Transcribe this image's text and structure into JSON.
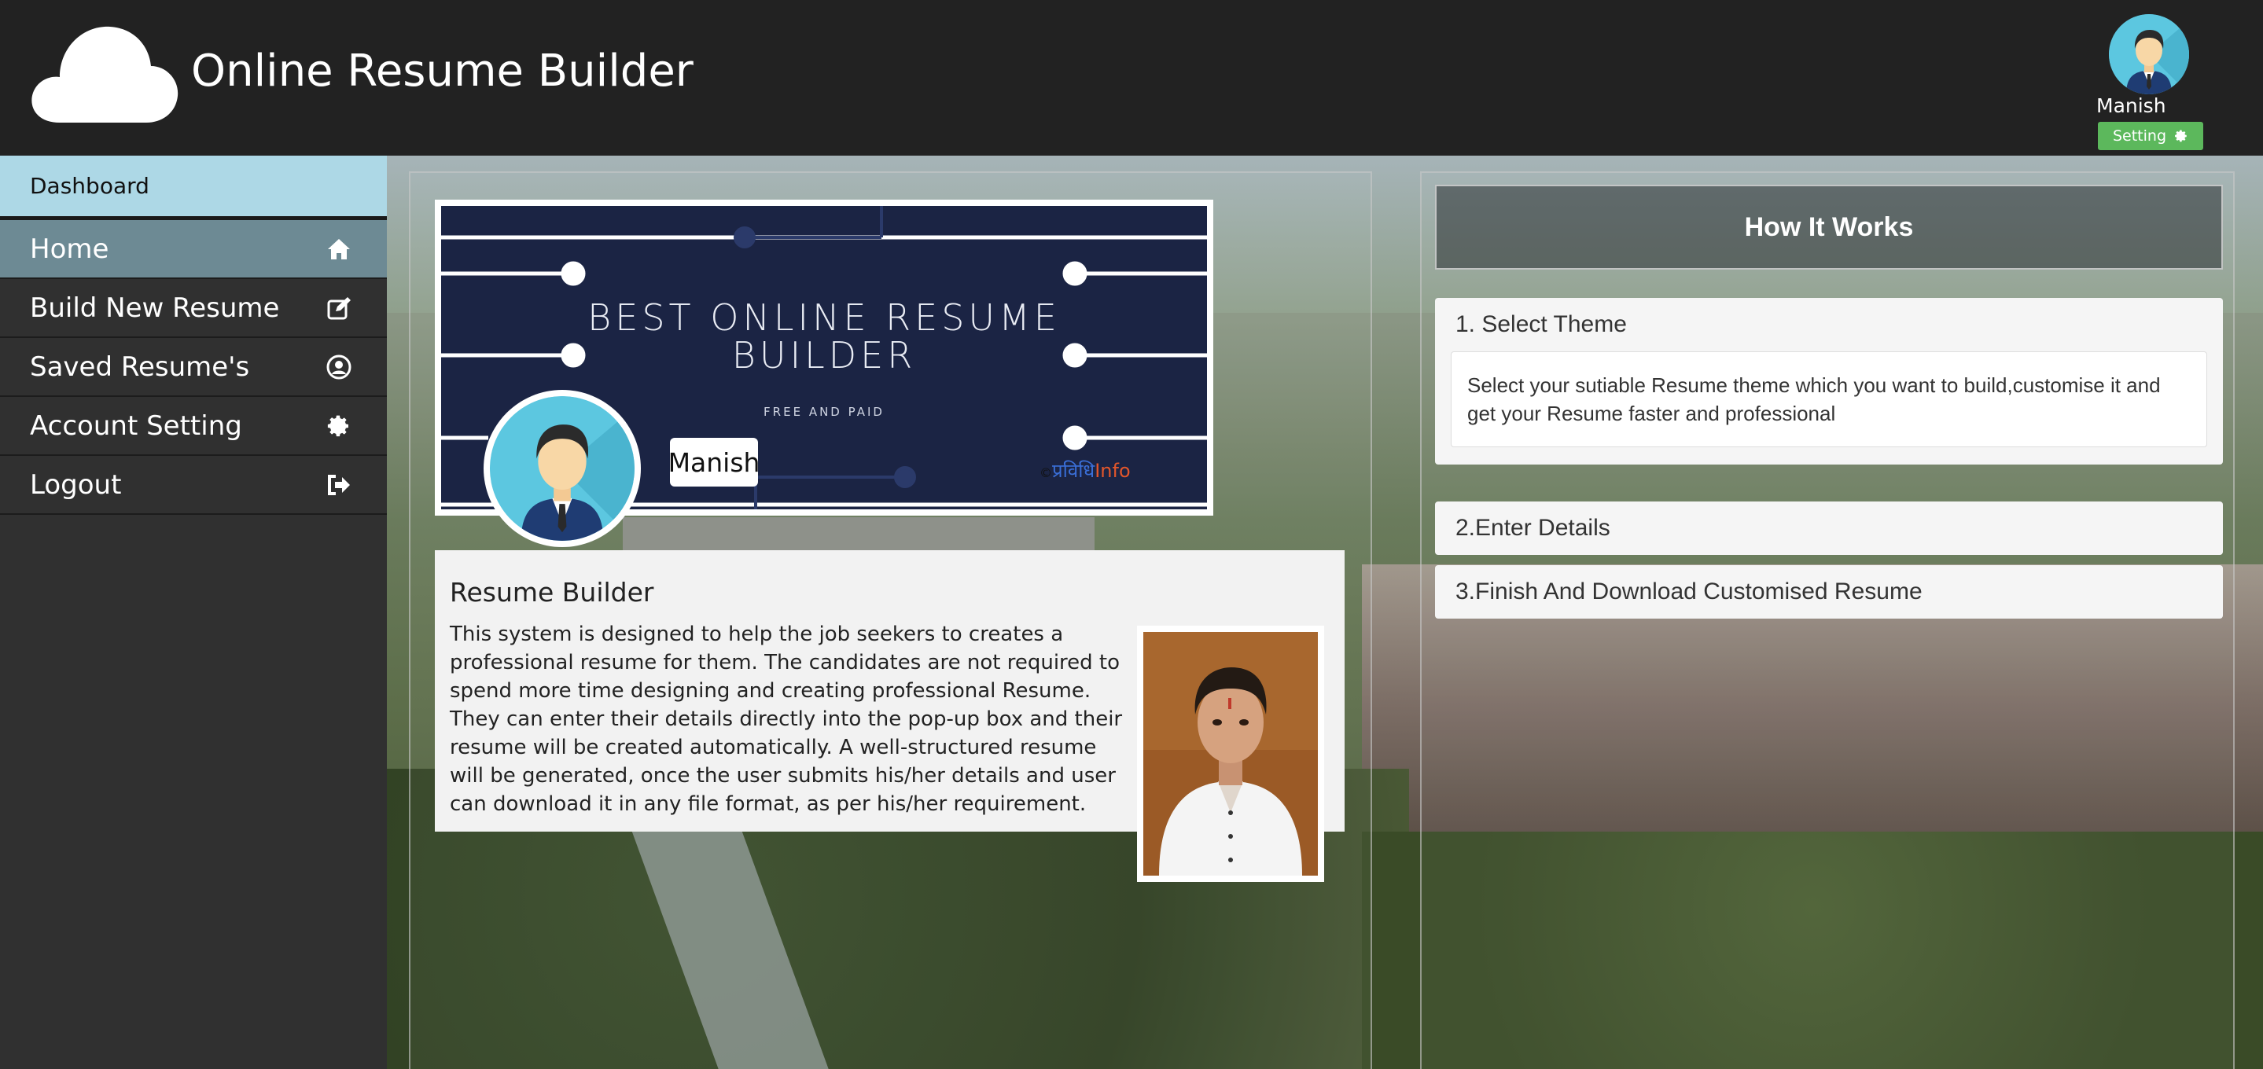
{
  "header": {
    "title": "Online Resume Builder",
    "user_name": "Manish",
    "setting_label": "Setting"
  },
  "sidebar": {
    "heading": "Dashboard",
    "items": [
      {
        "label": "Home",
        "icon": "home-icon"
      },
      {
        "label": "Build New Resume",
        "icon": "edit-icon"
      },
      {
        "label": "Saved Resume's",
        "icon": "user-circle-icon"
      },
      {
        "label": "Account Setting",
        "icon": "gear-icon"
      },
      {
        "label": "Logout",
        "icon": "sign-out-icon"
      }
    ]
  },
  "banner": {
    "title_line1": "BEST ONLINE RESUME",
    "title_line2": "BUILDER",
    "subtitle": "FREE AND PAID",
    "name": "Manish",
    "brand_prefix": "©",
    "brand_hindi": "प्रविधि",
    "brand_suffix": "Info"
  },
  "info": {
    "title": "Resume Builder",
    "text": "This system is designed to help the job seekers to creates a professional resume for them. The candidates are not required to spend more time designing and creating professional Resume. They can enter their details directly into the pop-up box and their resume will be created automatically. A well-structured resume will be generated, once the user submits his/her details and user can download it in any file format, as per his/her requirement."
  },
  "how_it_works": {
    "title": "How It Works",
    "steps": [
      {
        "title": "1. Select Theme",
        "body": "Select your sutiable Resume theme which you want to build,customise it and get your Resume faster and professional"
      },
      {
        "title": "2.Enter Details"
      },
      {
        "title": "3.Finish And Download Customised Resume"
      }
    ]
  },
  "colors": {
    "header_bg": "#222222",
    "sidebar_bg": "#303030",
    "sidebar_heading_bg": "#add8e6",
    "active_item_bg": "#6d8a94",
    "setting_button": "#5cb85c",
    "banner_bg": "#1b2444"
  }
}
